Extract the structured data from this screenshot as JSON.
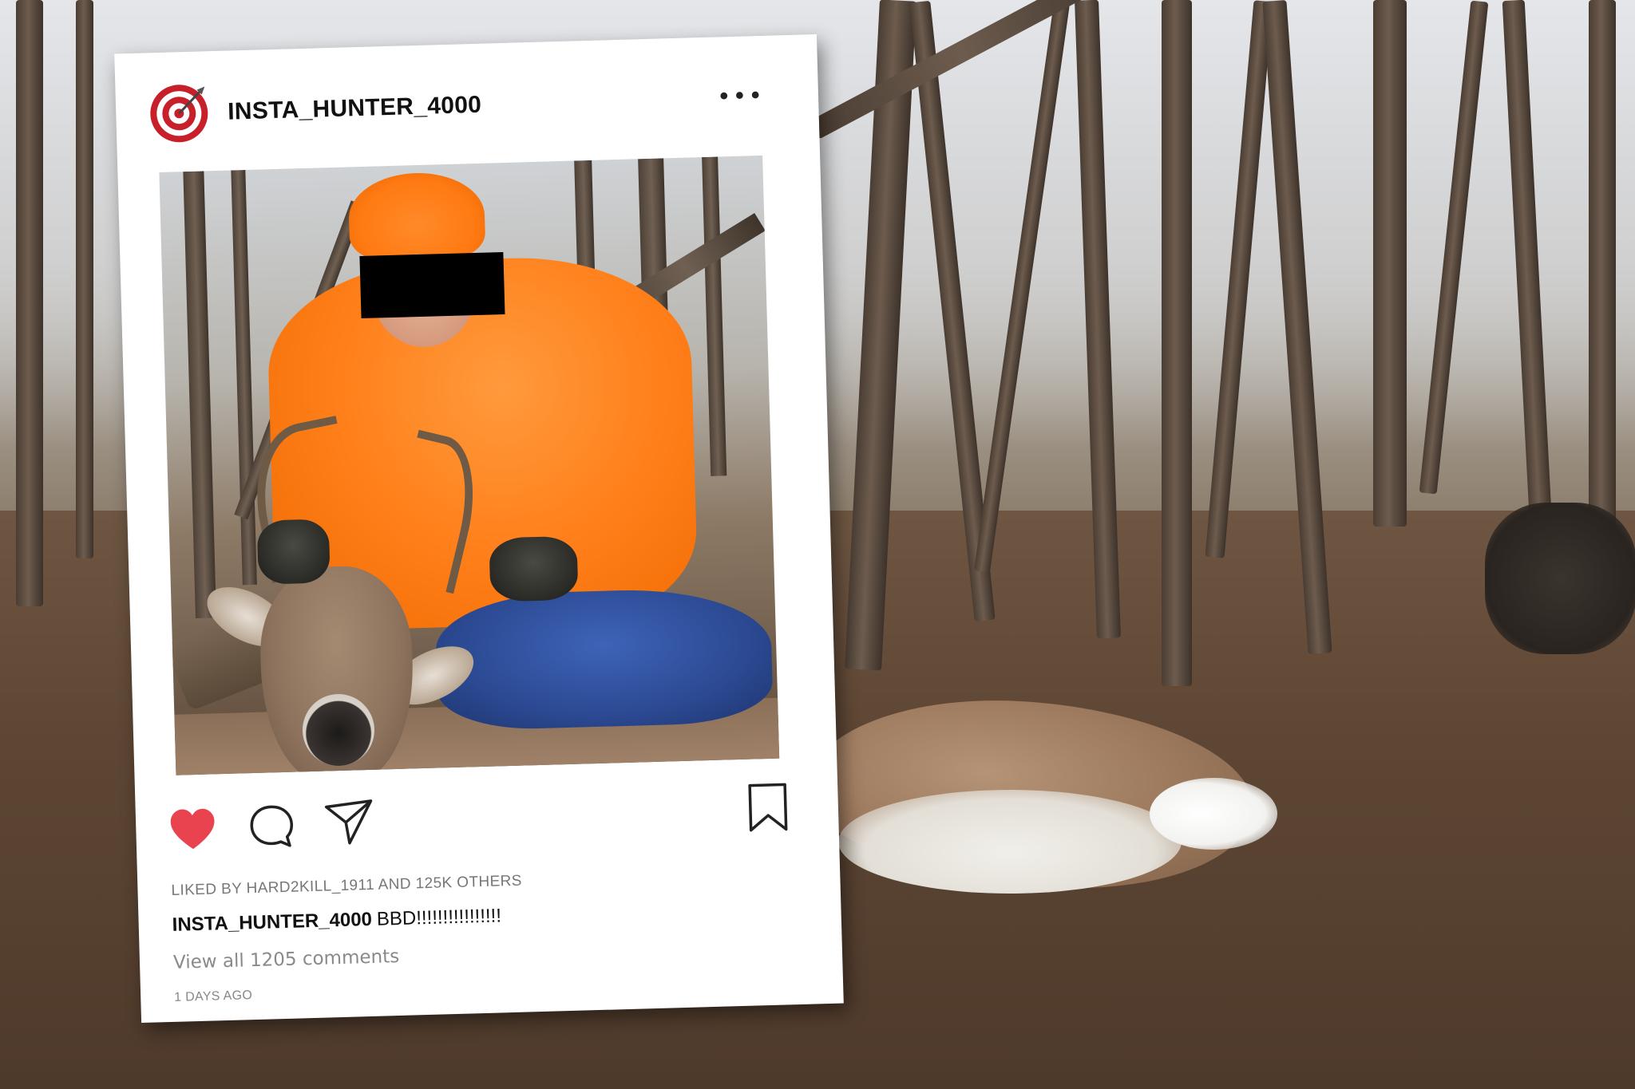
{
  "post": {
    "username": "INSTA_HUNTER_4000",
    "more_label": "•••",
    "liked_by": "LIKED BY HARD2KILL_1911 AND 125K OTHERS",
    "caption_user": "INSTA_HUNTER_4000",
    "caption_text": "BBD!!!!!!!!!!!!!!!!",
    "view_comments": "View all 1205 comments",
    "timestamp": "1 DAYS AGO"
  },
  "icons": {
    "avatar": "target-icon",
    "like": "heart-icon",
    "comment": "comment-icon",
    "share": "paper-plane-icon",
    "save": "bookmark-icon"
  },
  "colors": {
    "heart": "#e8434f",
    "avatar_red": "#c8202a"
  }
}
